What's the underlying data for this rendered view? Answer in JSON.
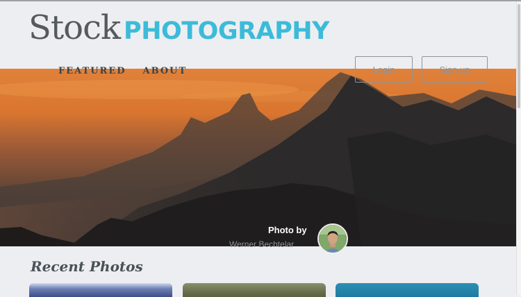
{
  "brand": {
    "word1": "Stock",
    "word2": "PHOTOGRAPHY",
    "accent": "#3cbbd9"
  },
  "nav": {
    "items": [
      {
        "label": "FEATURED"
      },
      {
        "label": "ABOUT"
      }
    ]
  },
  "auth": {
    "login_label": "Login",
    "signup_label": "Sign up"
  },
  "hero": {
    "credit_label": "Photo by",
    "photographer": "Werner Bechtelar"
  },
  "recent": {
    "title": "Recent Photos"
  }
}
